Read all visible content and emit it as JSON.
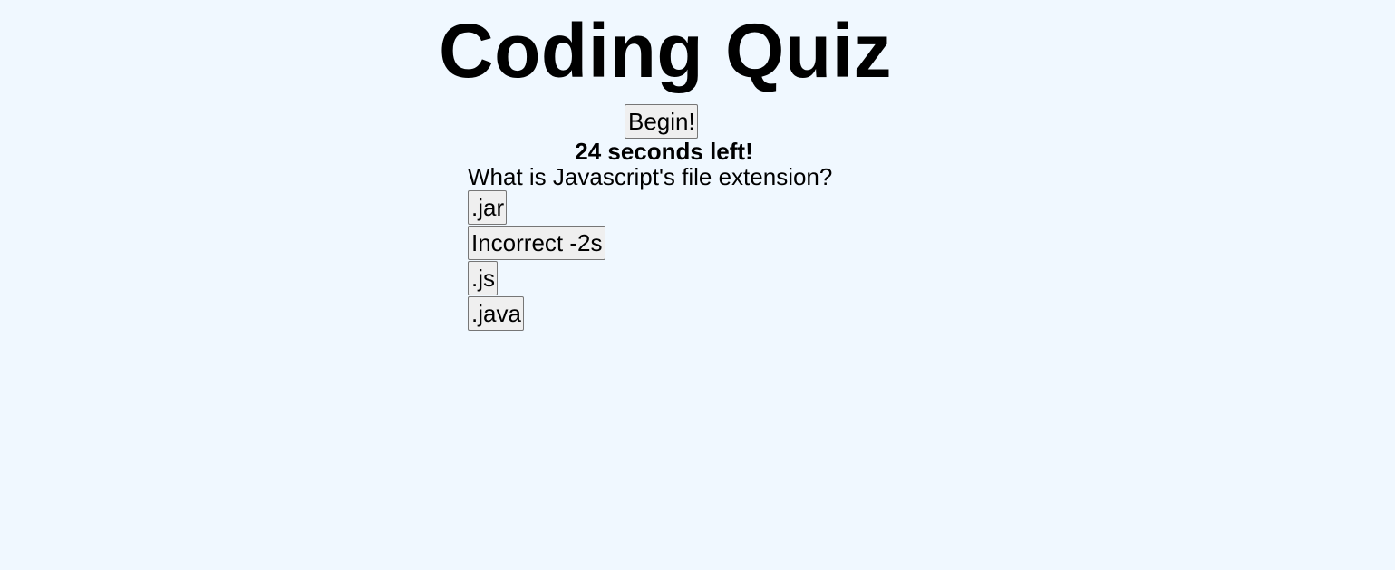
{
  "header": {
    "title": "Coding Quiz"
  },
  "controls": {
    "begin_label": "Begin!"
  },
  "timer": {
    "text": "24 seconds left!"
  },
  "quiz": {
    "question": "What is Javascript's file extension?",
    "choices": [
      ".jar",
      "Incorrect -2s",
      ".js",
      ".java"
    ]
  },
  "colors": {
    "background": "#f0f8ff",
    "button_bg": "#efefef",
    "button_border": "#767676"
  }
}
